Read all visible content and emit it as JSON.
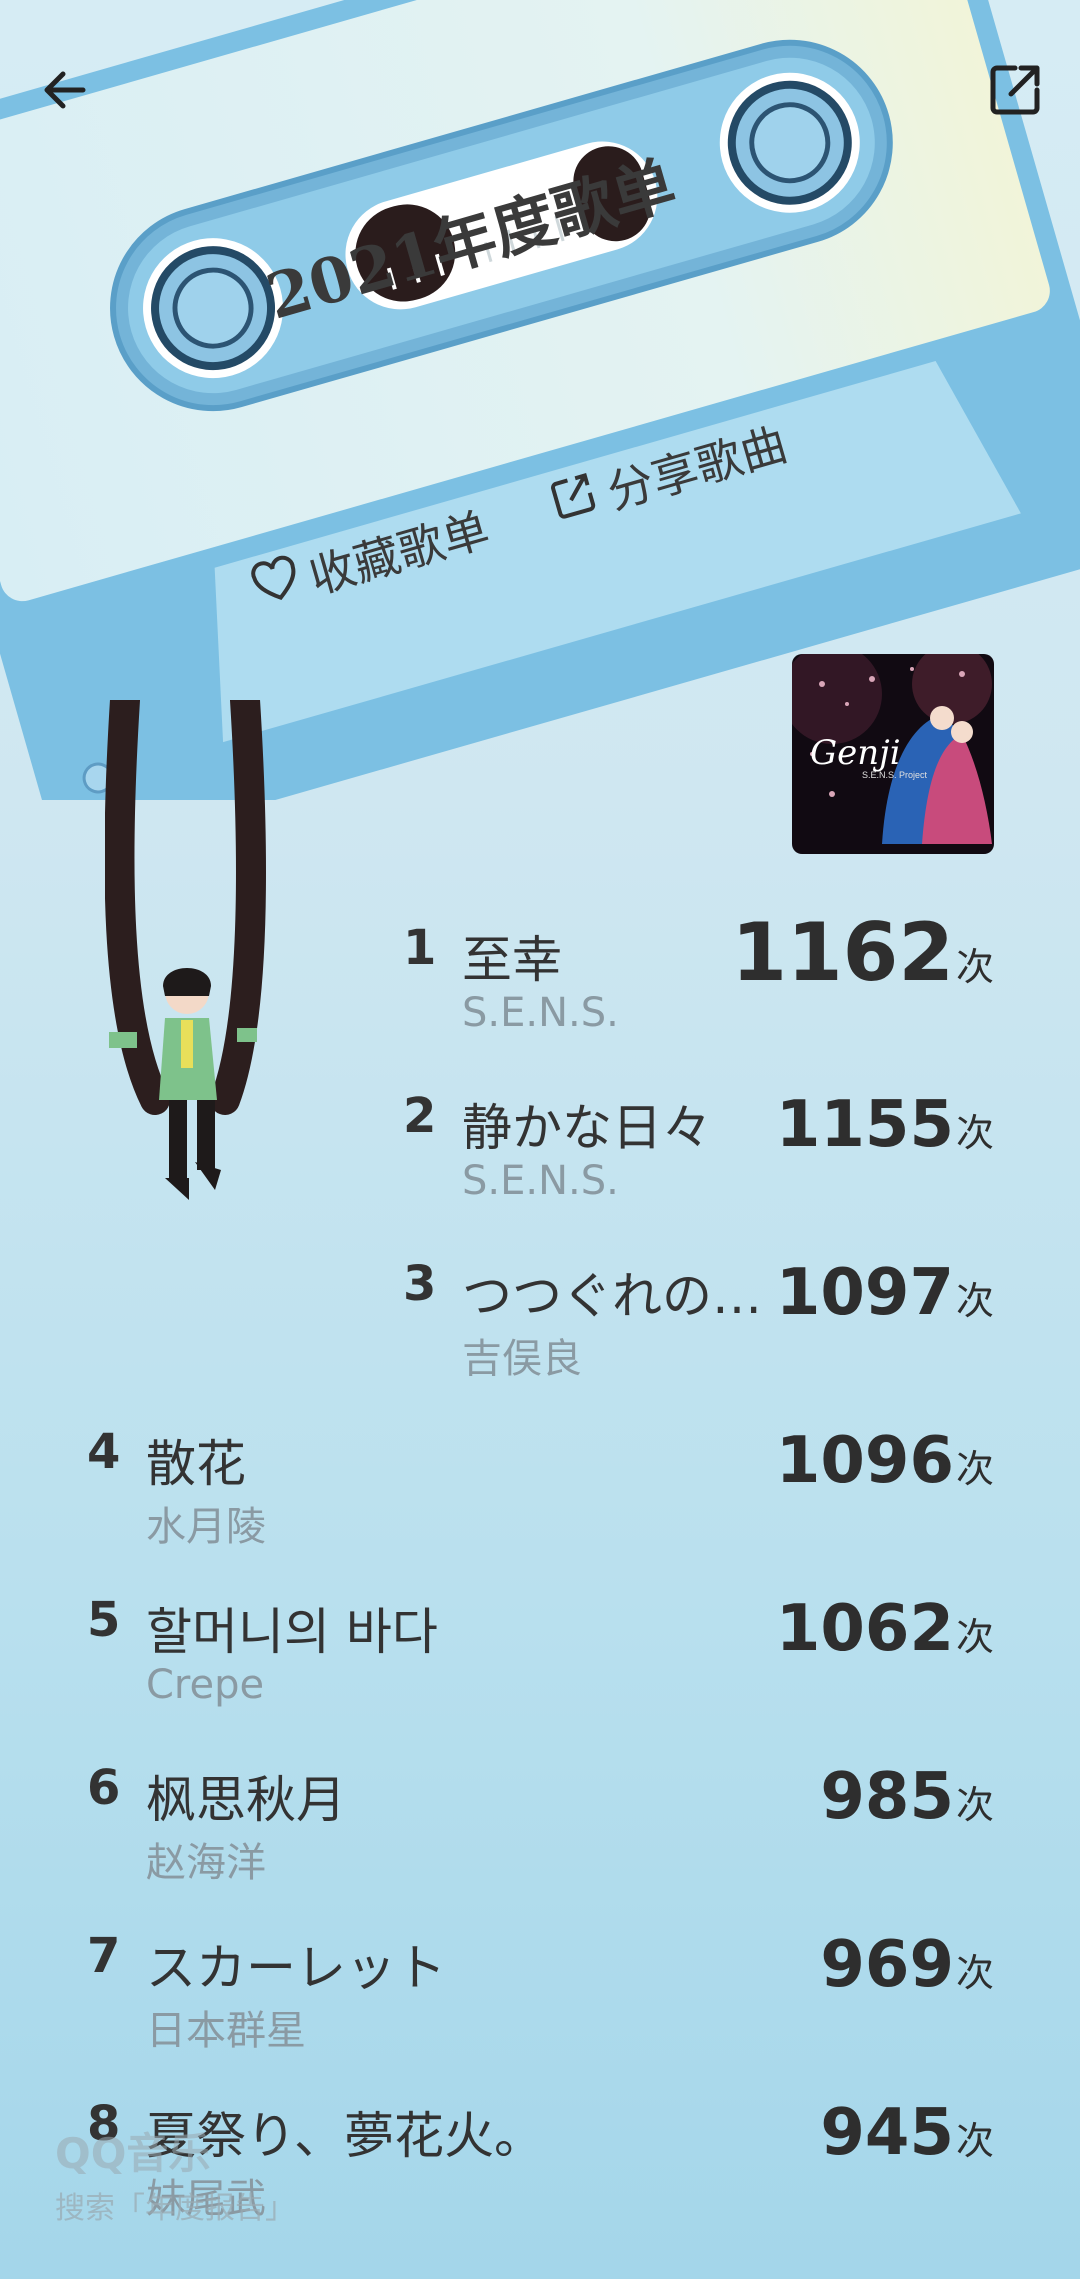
{
  "playlist": {
    "title": "2021年度歌单",
    "collect_label": "收藏歌单",
    "share_label": "分享歌曲"
  },
  "icons": {
    "back": "back-arrow-icon",
    "share": "external-share-icon",
    "heart": "heart-icon",
    "share_small": "share-icon"
  },
  "colors": {
    "cassette_blue": "#7cc0e3",
    "label_bg": "#e6f4f7",
    "accent_text": "#333333"
  },
  "songs": [
    {
      "rank": "1",
      "title": "至幸",
      "artist": "S.E.N.S.",
      "count": "1162",
      "unit": "次"
    },
    {
      "rank": "2",
      "title": "静かな日々",
      "artist": "S.E.N.S.",
      "count": "1155",
      "unit": "次"
    },
    {
      "rank": "3",
      "title": "つつぐれの…",
      "artist": "吉俣良",
      "count": "1097",
      "unit": "次"
    },
    {
      "rank": "4",
      "title": "散花",
      "artist": "水月陵",
      "count": "1096",
      "unit": "次"
    },
    {
      "rank": "5",
      "title": "할머니의 바다",
      "artist": "Crepe",
      "count": "1062",
      "unit": "次"
    },
    {
      "rank": "6",
      "title": "枫思秋月",
      "artist": "赵海洋",
      "count": "985",
      "unit": "次"
    },
    {
      "rank": "7",
      "title": "スカーレット",
      "artist": "日本群星",
      "count": "969",
      "unit": "次"
    },
    {
      "rank": "8",
      "title": "夏祭り、夢花火。",
      "artist": "妹尾武",
      "count": "945",
      "unit": "次"
    }
  ],
  "watermark": {
    "brand": "QQ音乐",
    "sub": "搜索「年度报告」"
  }
}
